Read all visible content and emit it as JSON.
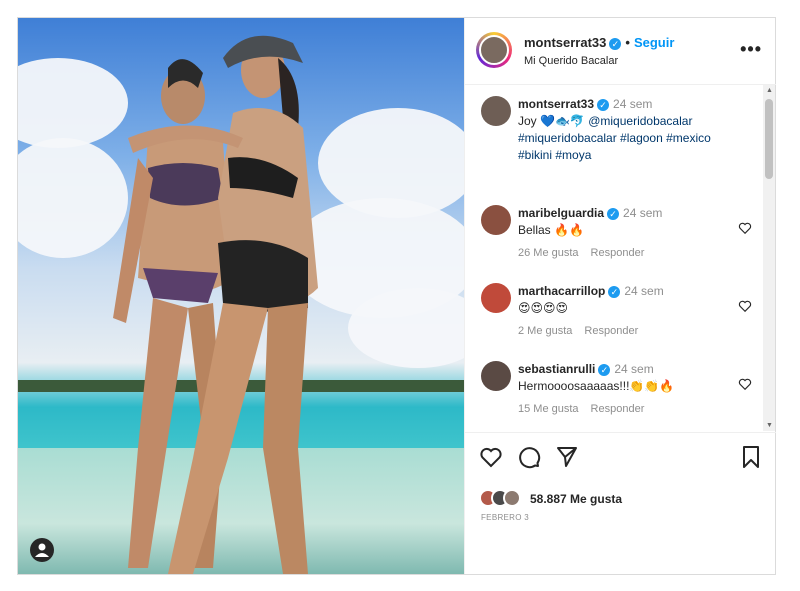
{
  "post": {
    "username": "montserrat33",
    "follow_label": "Seguir",
    "location": "Mi Querido Bacalar",
    "more_icon": "more-icon",
    "caption": {
      "username": "montserrat33",
      "time": "24 sem",
      "text_prefix": "Joy",
      "emoji": "💙🐟🐬",
      "mention": "@miqueridobacalar",
      "hashtags_line1": "#miqueridobacalar #lagoon #mexico",
      "hashtags_line2": "#bikini #moya"
    },
    "comments": [
      {
        "username": "maribelguardia",
        "time": "24 sem",
        "text": "Bellas 🔥🔥",
        "likes": "26 Me gusta",
        "reply": "Responder"
      },
      {
        "username": "marthacarrillop",
        "time": "24 sem",
        "text": "😍😍😍😍",
        "likes": "2 Me gusta",
        "reply": "Responder"
      },
      {
        "username": "sebastianrulli",
        "time": "24 sem",
        "text": "Hermoooosaaaaas!!!👏👏🔥",
        "likes": "15 Me gusta",
        "reply": "Responder"
      }
    ],
    "like_count_text": "58.887 Me gusta",
    "date": "FEBRERO 3"
  },
  "colors": {
    "accent": "#0095f6",
    "verified": "#1d9bf0",
    "muted": "#8e8e8e",
    "text": "#262626"
  }
}
